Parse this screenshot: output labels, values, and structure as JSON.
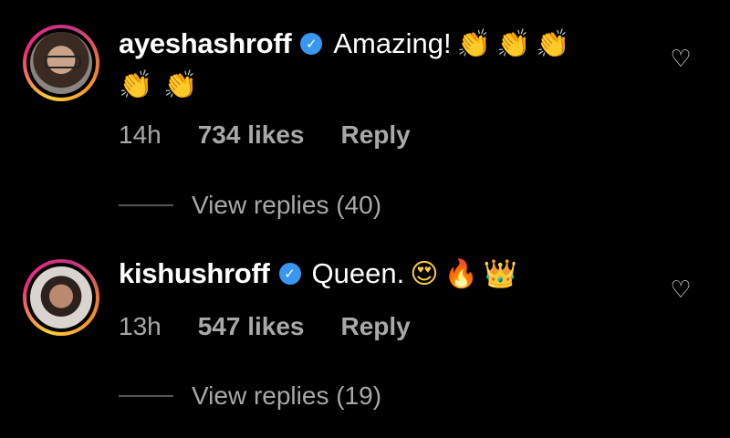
{
  "comments": [
    {
      "username": "ayeshashroff",
      "verified_glyph": "✓",
      "text": "Amazing!",
      "emojis_line1": [
        "👏",
        "👏",
        "👏"
      ],
      "emojis_line2": [
        "👏",
        "👏"
      ],
      "time": "14h",
      "likes": "734 likes",
      "reply_label": "Reply",
      "view_replies": "View replies (40)"
    },
    {
      "username": "kishushroff",
      "verified_glyph": "✓",
      "text": "Queen.",
      "emojis_line1": [
        "😍",
        "🔥",
        "👑"
      ],
      "time": "13h",
      "likes": "547 likes",
      "reply_label": "Reply",
      "view_replies": "View replies (19)"
    }
  ],
  "icons": {
    "like": "♡"
  },
  "colors": {
    "background": "#000000",
    "verified": "#3897f0",
    "meta": "#a8a8a8"
  }
}
